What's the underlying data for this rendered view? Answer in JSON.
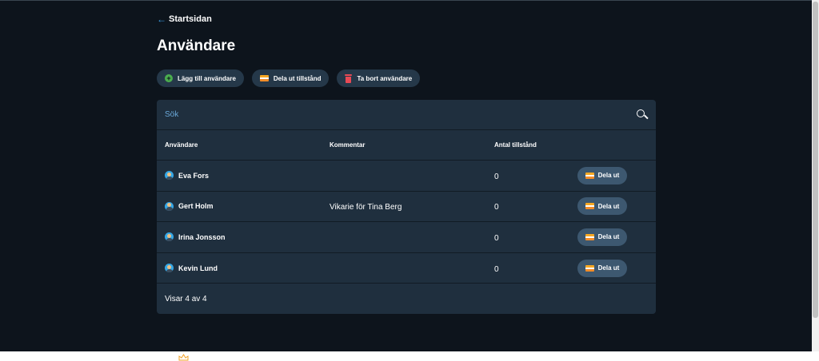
{
  "nav": {
    "back_label": "Startsidan"
  },
  "page": {
    "title": "Användare"
  },
  "toolbar": {
    "add_user": "Lägg till användare",
    "distribute_license": "Dela ut tillstånd",
    "delete_user": "Ta bort användare"
  },
  "search": {
    "placeholder": "Sök"
  },
  "table": {
    "headers": {
      "user": "Användare",
      "comment": "Kommentar",
      "count": "Antal tillstånd"
    },
    "rows": [
      {
        "name": "Eva Fors",
        "comment": "",
        "count": "0",
        "action": "Dela ut"
      },
      {
        "name": "Gert Holm",
        "comment": "Vikarie för Tina Berg",
        "count": "0",
        "action": "Dela ut"
      },
      {
        "name": "Irina Jonsson",
        "comment": "",
        "count": "0",
        "action": "Dela ut"
      },
      {
        "name": "Kevin Lund",
        "comment": "",
        "count": "0",
        "action": "Dela ut"
      }
    ]
  },
  "footer": {
    "summary": "Visar 4 av 4"
  },
  "icons": {
    "back": "arrow-left-icon",
    "add": "plus-circle-icon",
    "license": "license-card-icon",
    "delete": "trash-icon",
    "search": "search-icon",
    "avatar": "user-avatar-icon"
  },
  "colors": {
    "background": "#0d141c",
    "panel": "#1f2f3e",
    "pill": "#253849",
    "accent": "#3b9be0",
    "add_green": "#4bae4f",
    "delete_red": "#e84a55"
  }
}
